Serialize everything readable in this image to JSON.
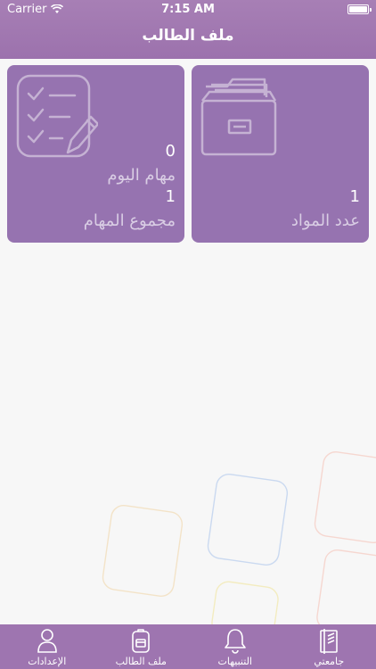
{
  "status_bar": {
    "carrier": "Carrier",
    "time": "7:15 AM"
  },
  "header": {
    "title": "ملف الطالب"
  },
  "cards": {
    "tasks": {
      "today_count": "0",
      "today_label": "مهام اليوم",
      "total_count": "1",
      "total_label": "مجموع المهام",
      "icon": "checklist-icon"
    },
    "subjects": {
      "count": "1",
      "label": "عدد المواد",
      "icon": "file-cabinet-icon"
    }
  },
  "tabbar": {
    "items": [
      {
        "label": "جامعتي",
        "icon": "book-icon"
      },
      {
        "label": "التنبيهات",
        "icon": "bell-icon"
      },
      {
        "label": "ملف الطالب",
        "icon": "backpack-icon"
      },
      {
        "label": "الإعدادات",
        "icon": "user-icon"
      }
    ]
  },
  "colors": {
    "accent": "#9e75b0",
    "card": "#9673b0"
  }
}
